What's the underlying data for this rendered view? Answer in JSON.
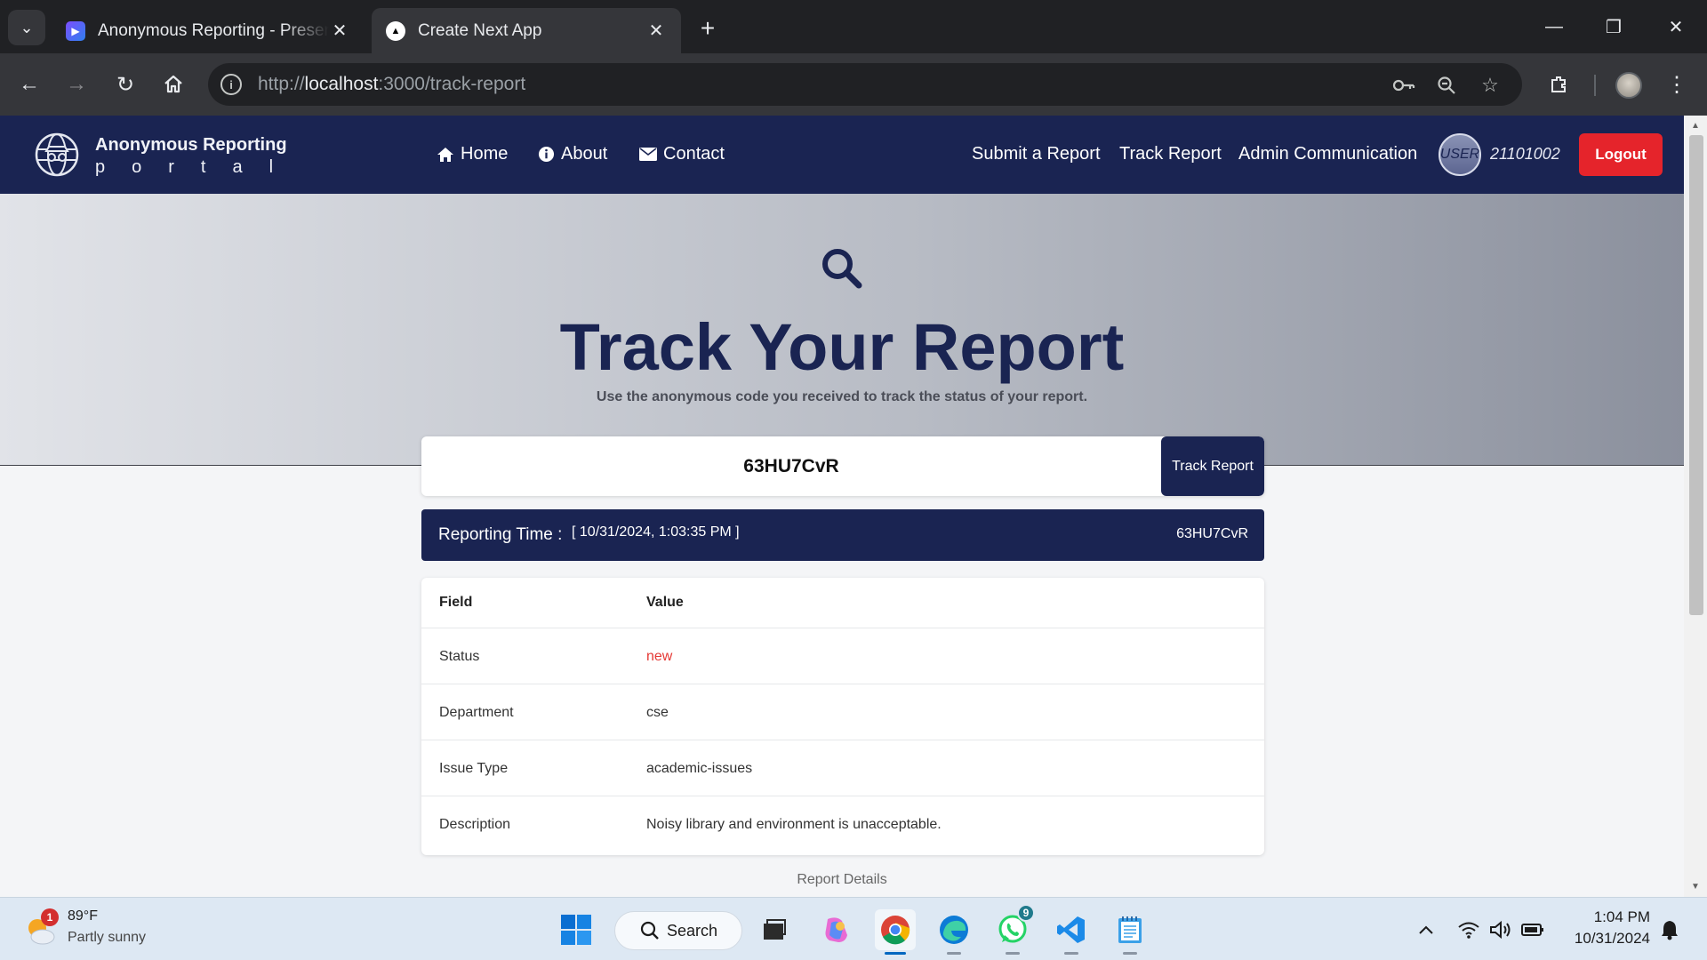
{
  "browser": {
    "tabs": [
      {
        "title": "Anonymous Reporting - Presentation",
        "active": false
      },
      {
        "title": "Create Next App",
        "active": true
      }
    ],
    "url_scheme_prefix": "http://",
    "url_host": "localhost",
    "url_rest": ":3000/track-report"
  },
  "navbar": {
    "brand_title": "Anonymous Reporting",
    "brand_subtitle": "portal",
    "links": {
      "home": "Home",
      "about": "About",
      "contact": "Contact",
      "submit": "Submit a Report",
      "track": "Track Report",
      "admin": "Admin Communication"
    },
    "user_badge": "USER",
    "user_id": "21101002",
    "logout": "Logout",
    "colors": {
      "bg": "#1a2452",
      "logout": "#e5242b"
    }
  },
  "hero": {
    "title": "Track Your Report",
    "subtitle": "Use the anonymous code you received to track the status of your report."
  },
  "search": {
    "value": "63HU7CvR",
    "button": "Track Report"
  },
  "report": {
    "time_label": "Reporting Time :",
    "time_value": "[ 10/31/2024, 1:03:35 PM ]",
    "code": "63HU7CvR",
    "table": {
      "headers": [
        "Field",
        "Value"
      ],
      "rows": [
        {
          "field": "Status",
          "value": "new"
        },
        {
          "field": "Department",
          "value": "cse"
        },
        {
          "field": "Issue Type",
          "value": "academic-issues"
        },
        {
          "field": "Description",
          "value": "Noisy library and environment is unacceptable."
        }
      ]
    },
    "caption": "Report Details",
    "status_color": "#e53935"
  },
  "taskbar": {
    "weather_temp": "89°F",
    "weather_desc": "Partly sunny",
    "weather_badge": "1",
    "search_label": "Search",
    "whatsapp_badge": "9",
    "time": "1:04 PM",
    "date": "10/31/2024"
  }
}
